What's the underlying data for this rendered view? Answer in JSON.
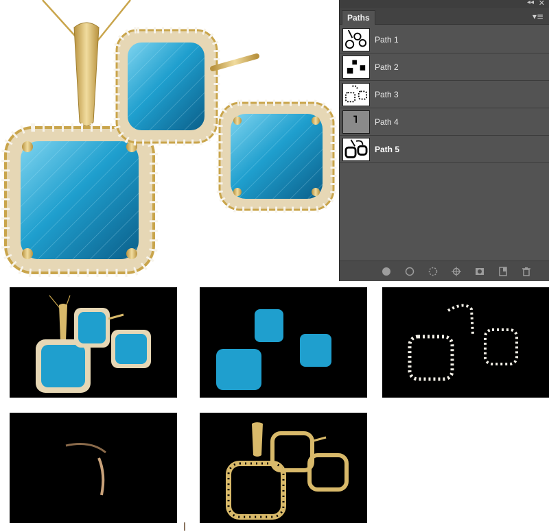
{
  "panel": {
    "tab_label": "Paths",
    "collapse_glyph": "◂◂",
    "close_glyph": "✕",
    "menu_glyph": "▾≡",
    "items": [
      {
        "label": "Path 1",
        "active": false
      },
      {
        "label": "Path 2",
        "active": false
      },
      {
        "label": "Path 3",
        "active": false
      },
      {
        "label": "Path 4",
        "active": false
      },
      {
        "label": "Path 5",
        "active": true
      }
    ],
    "footer_icons": [
      "fill-path-icon",
      "stroke-path-icon",
      "load-selection-icon",
      "make-work-path-icon",
      "add-mask-icon",
      "new-path-icon",
      "trash-icon"
    ]
  },
  "colors": {
    "panel_bg": "#535353",
    "gem_blue": "#1f9fce",
    "gold": "#d8b96a",
    "tile_bg": "#000000"
  }
}
